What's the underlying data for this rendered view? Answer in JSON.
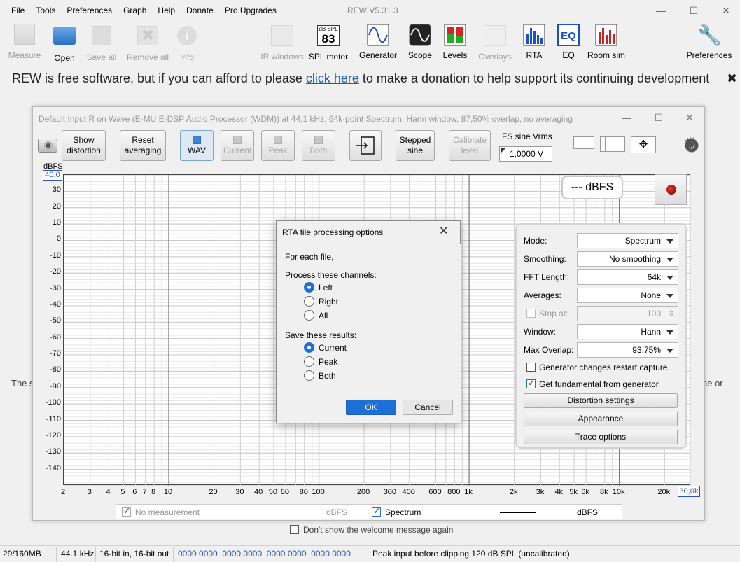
{
  "menu": [
    "File",
    "Tools",
    "Preferences",
    "Graph",
    "Help",
    "Donate",
    "Pro Upgrades"
  ],
  "app_title": "REW V5.31.3",
  "toolbar": [
    {
      "label": "Measure",
      "icon": "measure-icon",
      "enabled": false
    },
    {
      "label": "Open",
      "icon": "folder-icon",
      "enabled": true
    },
    {
      "label": "Save all",
      "icon": "disk-icon",
      "enabled": false
    },
    {
      "label": "Remove all",
      "icon": "remove-icon",
      "enabled": false
    },
    {
      "label": "Info",
      "icon": "info-icon",
      "enabled": false
    },
    {
      "label": "IR windows",
      "icon": "ir-windows-icon",
      "enabled": false
    },
    {
      "label": "SPL meter",
      "icon": "spl-meter-icon",
      "enabled": true
    },
    {
      "label": "Generator",
      "icon": "generator-icon",
      "enabled": true
    },
    {
      "label": "Scope",
      "icon": "scope-icon",
      "enabled": true
    },
    {
      "label": "Levels",
      "icon": "levels-icon",
      "enabled": true
    },
    {
      "label": "Overlays",
      "icon": "overlays-icon",
      "enabled": false
    },
    {
      "label": "RTA",
      "icon": "rta-icon",
      "enabled": true
    },
    {
      "label": "EQ",
      "icon": "eq-icon",
      "enabled": true
    },
    {
      "label": "Room sim",
      "icon": "room-sim-icon",
      "enabled": true
    },
    {
      "label": "Preferences",
      "icon": "wrench-icon",
      "enabled": true
    }
  ],
  "spl_icon": {
    "unit": "dB SPL",
    "value": "83"
  },
  "donate": {
    "before": "REW is free software, but if you can afford to please ",
    "link": "click here",
    "after": " to make a donation to help support its continuing development",
    "close": "✖"
  },
  "background_text": {
    "left": "The s",
    "right": "ne or"
  },
  "rta": {
    "title": "Default Input R on Wave (E-MU E-DSP Audio Processor (WDM)) at 44,1 kHz, 64k-point Spectrum, Hann window, 87,50% overlap, no averaging",
    "buttons": {
      "show_distortion": "Show distortion",
      "reset_averaging": "Reset averaging",
      "wav": "WAV",
      "current": "Current",
      "peak": "Peak",
      "both": "Both",
      "stepped_sine": "Stepped sine",
      "calibrate_level": "Calibrate level"
    },
    "fs_label": "FS sine Vrms",
    "fs_value": "1,0000 V",
    "readout": "--- dBFS",
    "graph": {
      "y_unit": "dBFS",
      "y_top": "40,0",
      "y_ticks": [
        "30",
        "20",
        "10",
        "0",
        "-10",
        "-20",
        "-30",
        "-40",
        "-50",
        "-60",
        "-70",
        "-80",
        "-90",
        "-100",
        "-110",
        "-120",
        "-130",
        "-140"
      ],
      "x_ticks": [
        "2",
        "3",
        "4",
        "5",
        "6",
        "7",
        "8",
        "10",
        "20",
        "30",
        "40",
        "50",
        "60",
        "80",
        "100",
        "200",
        "300",
        "400",
        "600",
        "800",
        "1k",
        "2k",
        "3k",
        "4k",
        "5k",
        "6k",
        "8k",
        "10k",
        "20k"
      ],
      "x_end": "30,0k"
    },
    "controls": {
      "mode_label": "Mode:",
      "mode_value": "Spectrum",
      "smoothing_label": "Smoothing:",
      "smoothing_value": "No smoothing",
      "fft_label": "FFT Length:",
      "fft_value": "64k",
      "averages_label": "Averages:",
      "averages_value": "None",
      "stop_at_label": "Stop at:",
      "stop_at_value": "100",
      "window_label": "Window:",
      "window_value": "Hann",
      "overlap_label": "Max Overlap:",
      "overlap_value": "93.75%",
      "gen_restart_label": "Generator changes restart capture",
      "fundamental_label": "Get fundamental from generator",
      "distortion_settings": "Distortion settings",
      "appearance": "Appearance",
      "trace_options": "Trace options"
    },
    "legend": {
      "no_measurement": "No measurement",
      "no_measurement_unit": "dBFS",
      "spectrum": "Spectrum",
      "spectrum_unit": "dBFS"
    }
  },
  "welcome": "Don't show the welcome message again",
  "status": {
    "memory": "29/160MB",
    "rate": "44.1 kHz",
    "bits": "16-bit in, 16-bit out",
    "bits_display": "0000 0000  0000 0000  0000 0000  0000 0000",
    "peak": "Peak input before clipping 120 dB SPL (uncalibrated)"
  },
  "dialog": {
    "title": "RTA file processing options",
    "intro": "For each file,",
    "channels_label": "Process these channels:",
    "channels": [
      "Left",
      "Right",
      "All"
    ],
    "channels_selected": 0,
    "results_label": "Save these results:",
    "results": [
      "Current",
      "Peak",
      "Both"
    ],
    "results_selected": 0,
    "ok": "OK",
    "cancel": "Cancel"
  }
}
